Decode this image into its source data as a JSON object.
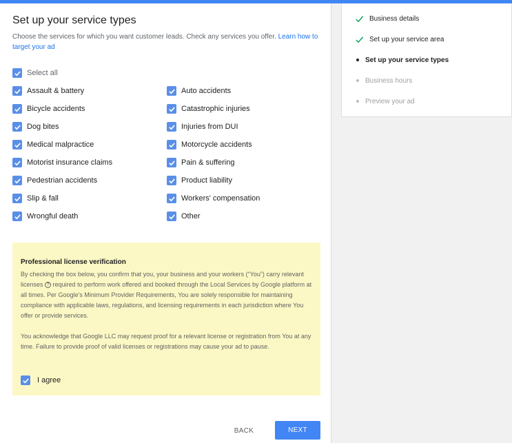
{
  "page": {
    "title": "Set up your service types",
    "description": "Choose the services for which you want customer leads. Check any services you offer.",
    "learn_link": "Learn how to target your ad"
  },
  "services": {
    "select_all": {
      "label": "Select all",
      "checked": true
    },
    "left": [
      {
        "label": "Assault & battery",
        "checked": true
      },
      {
        "label": "Bicycle accidents",
        "checked": true
      },
      {
        "label": "Dog bites",
        "checked": true
      },
      {
        "label": "Medical malpractice",
        "checked": true
      },
      {
        "label": "Motorist insurance claims",
        "checked": true
      },
      {
        "label": "Pedestrian accidents",
        "checked": true
      },
      {
        "label": "Slip & fall",
        "checked": true
      },
      {
        "label": "Wrongful death",
        "checked": true
      }
    ],
    "right": [
      {
        "label": "Auto accidents",
        "checked": true
      },
      {
        "label": "Catastrophic injuries",
        "checked": true
      },
      {
        "label": "Injuries from DUI",
        "checked": true
      },
      {
        "label": "Motorcycle accidents",
        "checked": true
      },
      {
        "label": "Pain & suffering",
        "checked": true
      },
      {
        "label": "Product liability",
        "checked": true
      },
      {
        "label": "Workers' compensation",
        "checked": true
      },
      {
        "label": "Other",
        "checked": true
      }
    ]
  },
  "license": {
    "title": "Professional license verification",
    "para1_a": "By checking the box below, you confirm that you, your business and your workers (“You”) carry relevant licenses",
    "help_icon": "help-circle-icon",
    "para1_b": "required to perform work offered and booked through the Local Services by Google platform at all times. Per Google’s Minimum Provider Requirements, You are solely responsible for maintaining compliance with applicable laws, regulations, and licensing requirements in each jurisdiction where You offer or provide services.",
    "para2": "You acknowledge that Google LLC may request proof for a relevant license or registration from You at any time. Failure to provide proof of valid licenses or registrations may cause your ad to pause.",
    "agree_label": "I agree",
    "agree_checked": true
  },
  "actions": {
    "back": "BACK",
    "next": "NEXT"
  },
  "steps": [
    {
      "label": "Business details",
      "state": "done"
    },
    {
      "label": "Set up your service area",
      "state": "done"
    },
    {
      "label": "Set up your service types",
      "state": "current"
    },
    {
      "label": "Business hours",
      "state": "future"
    },
    {
      "label": "Preview your ad",
      "state": "future"
    }
  ],
  "colors": {
    "accent": "#4285f4",
    "checkbox": "#5a8fe8",
    "check_done": "#0f9d58",
    "notice_bg": "#fbf8c5"
  }
}
